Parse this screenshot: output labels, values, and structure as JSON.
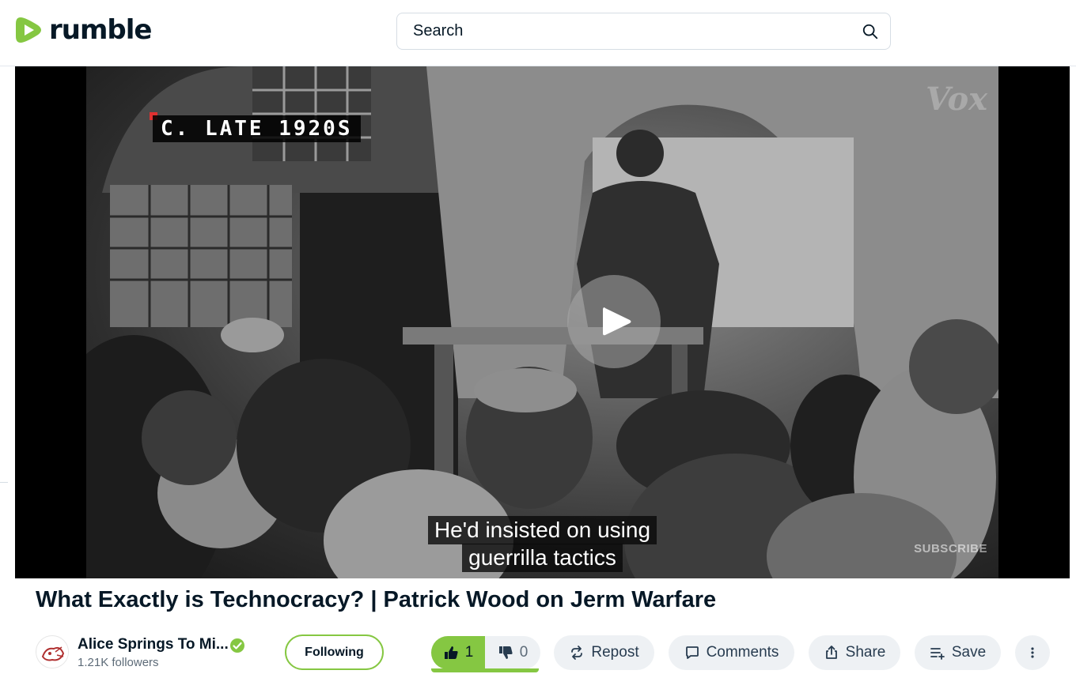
{
  "header": {
    "logo_text": "rumble",
    "search_placeholder": "Search"
  },
  "video": {
    "date_overlay": "C. LATE 1920S",
    "watermark": "Vox",
    "subscribe_overlay": "SUBSCRIBE",
    "caption_line1": "He'd insisted on using",
    "caption_line2": "guerrilla tactics"
  },
  "info": {
    "title": "What Exactly is Technocracy? | Patrick Wood on Jerm Warfare",
    "channel_name": "Alice Springs To Mi...",
    "followers": "1.21K followers",
    "follow_label": "Following"
  },
  "actions": {
    "upvotes": "1",
    "downvotes": "0",
    "repost_label": "Repost",
    "comments_label": "Comments",
    "share_label": "Share",
    "save_label": "Save"
  },
  "colors": {
    "brand_green": "#85c742",
    "text_dark": "#061826",
    "pill_bg": "#eef1f4"
  }
}
